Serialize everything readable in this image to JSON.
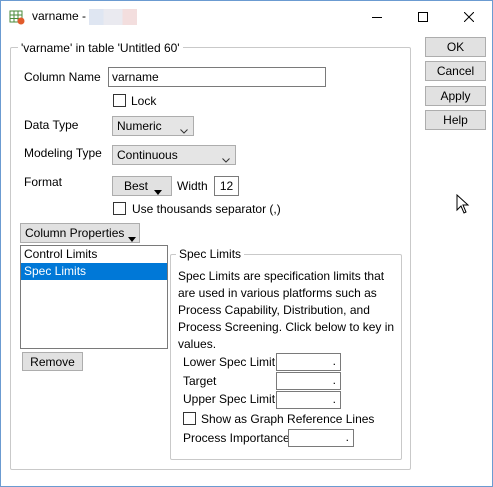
{
  "window": {
    "title": "varname -"
  },
  "group": {
    "legend": "'varname' in table 'Untitled 60'"
  },
  "fields": {
    "column_name_label": "Column Name",
    "column_name_value": "varname",
    "lock_label": "Lock",
    "data_type_label": "Data Type",
    "data_type_value": "Numeric",
    "modeling_type_label": "Modeling Type",
    "modeling_type_value": "Continuous",
    "format_label": "Format",
    "format_value": "Best",
    "width_label": "Width",
    "width_value": "12",
    "thousands_label": "Use thousands separator (,)"
  },
  "column_properties": {
    "button_label": "Column Properties",
    "items": [
      {
        "label": "Control Limits",
        "selected": false
      },
      {
        "label": "Spec Limits",
        "selected": true
      }
    ],
    "remove_label": "Remove"
  },
  "spec_limits": {
    "legend": "Spec Limits",
    "description": "Spec Limits are specification limits that are used in various platforms such as Process Capability, Distribution, and Process Screening. Click below to key in values.",
    "lower_label": "Lower Spec Limit",
    "lower_value": ".",
    "target_label": "Target",
    "target_value": ".",
    "upper_label": "Upper Spec Limit",
    "upper_value": ".",
    "reference_lines_label": "Show as Graph Reference Lines",
    "importance_label": "Process Importance",
    "importance_value": "."
  },
  "buttons": {
    "ok": "OK",
    "cancel": "Cancel",
    "apply": "Apply",
    "help": "Help"
  },
  "icons": {
    "app": "jmp-table-icon",
    "minimize": "minimize-icon",
    "maximize": "maximize-icon",
    "close": "close-icon"
  }
}
